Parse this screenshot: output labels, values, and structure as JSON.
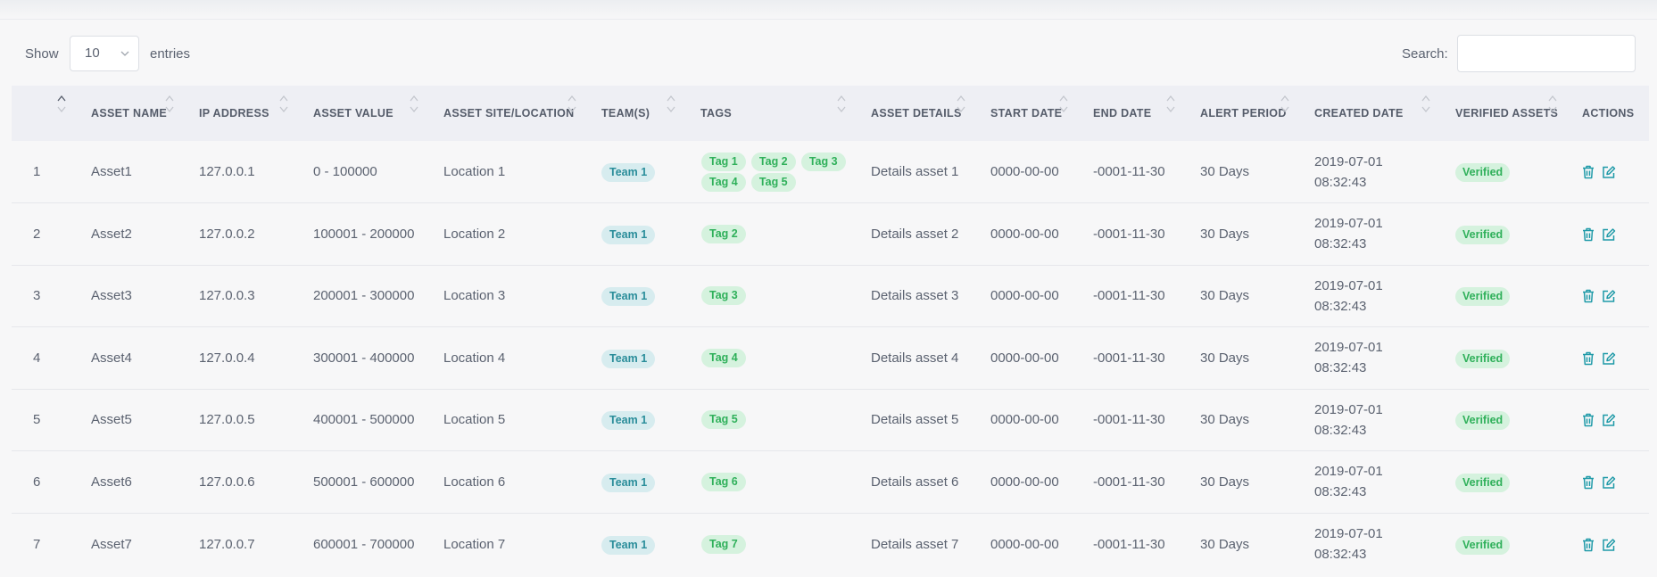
{
  "controls": {
    "show_label": "Show",
    "entries_value": "10",
    "entries_label": "entries",
    "search_label": "Search:",
    "search_value": ""
  },
  "columns": [
    {
      "key": "num",
      "label": ""
    },
    {
      "key": "name",
      "label": "ASSET NAME"
    },
    {
      "key": "ip",
      "label": "IP ADDRESS"
    },
    {
      "key": "value",
      "label": "ASSET VALUE"
    },
    {
      "key": "site",
      "label": "ASSET SITE/LOCATION"
    },
    {
      "key": "teams",
      "label": "TEAM(S)"
    },
    {
      "key": "tags",
      "label": "TAGS"
    },
    {
      "key": "details",
      "label": "ASSET DETAILS"
    },
    {
      "key": "start",
      "label": "START DATE"
    },
    {
      "key": "end",
      "label": "END DATE"
    },
    {
      "key": "alert",
      "label": "ALERT PERIOD"
    },
    {
      "key": "created",
      "label": "CREATED DATE"
    },
    {
      "key": "verified",
      "label": "VERIFIED ASSETS"
    },
    {
      "key": "actions",
      "label": "ACTIONS"
    }
  ],
  "rows": [
    {
      "num": "1",
      "name": "Asset1",
      "ip": "127.0.0.1",
      "value": "0 - 100000",
      "site": "Location 1",
      "team": "Team 1",
      "tags": [
        "Tag 1",
        "Tag 2",
        "Tag 3",
        "Tag 4",
        "Tag 5"
      ],
      "details": "Details asset 1",
      "start": "0000-00-00",
      "end": "-0001-11-30",
      "alert": "30 Days",
      "created": "2019-07-01 08:32:43",
      "verified": "Verified"
    },
    {
      "num": "2",
      "name": "Asset2",
      "ip": "127.0.0.2",
      "value": "100001 - 200000",
      "site": "Location 2",
      "team": "Team 1",
      "tags": [
        "Tag 2"
      ],
      "details": "Details asset 2",
      "start": "0000-00-00",
      "end": "-0001-11-30",
      "alert": "30 Days",
      "created": "2019-07-01 08:32:43",
      "verified": "Verified"
    },
    {
      "num": "3",
      "name": "Asset3",
      "ip": "127.0.0.3",
      "value": "200001 - 300000",
      "site": "Location 3",
      "team": "Team 1",
      "tags": [
        "Tag 3"
      ],
      "details": "Details asset 3",
      "start": "0000-00-00",
      "end": "-0001-11-30",
      "alert": "30 Days",
      "created": "2019-07-01 08:32:43",
      "verified": "Verified"
    },
    {
      "num": "4",
      "name": "Asset4",
      "ip": "127.0.0.4",
      "value": "300001 - 400000",
      "site": "Location 4",
      "team": "Team 1",
      "tags": [
        "Tag 4"
      ],
      "details": "Details asset 4",
      "start": "0000-00-00",
      "end": "-0001-11-30",
      "alert": "30 Days",
      "created": "2019-07-01 08:32:43",
      "verified": "Verified"
    },
    {
      "num": "5",
      "name": "Asset5",
      "ip": "127.0.0.5",
      "value": "400001 - 500000",
      "site": "Location 5",
      "team": "Team 1",
      "tags": [
        "Tag 5"
      ],
      "details": "Details asset 5",
      "start": "0000-00-00",
      "end": "-0001-11-30",
      "alert": "30 Days",
      "created": "2019-07-01 08:32:43",
      "verified": "Verified"
    },
    {
      "num": "6",
      "name": "Asset6",
      "ip": "127.0.0.6",
      "value": "500001 - 600000",
      "site": "Location 6",
      "team": "Team 1",
      "tags": [
        "Tag 6"
      ],
      "details": "Details asset 6",
      "start": "0000-00-00",
      "end": "-0001-11-30",
      "alert": "30 Days",
      "created": "2019-07-01 08:32:43",
      "verified": "Verified"
    },
    {
      "num": "7",
      "name": "Asset7",
      "ip": "127.0.0.7",
      "value": "600001 - 700000",
      "site": "Location 7",
      "team": "Team 1",
      "tags": [
        "Tag 7"
      ],
      "details": "Details asset 7",
      "start": "0000-00-00",
      "end": "-0001-11-30",
      "alert": "30 Days",
      "created": "2019-07-01 08:32:43",
      "verified": "Verified"
    }
  ],
  "icons": {
    "delete": "trash-icon",
    "edit": "edit-icon",
    "sort": "sort-icon",
    "dropdown": "chevron-down-icon"
  },
  "colors": {
    "team_badge_bg": "#d7ecef",
    "team_badge_text": "#2a8d9a",
    "tag_badge_bg": "#d5f2de",
    "tag_badge_text": "#2fb05a",
    "action_icon": "#1f9aa8",
    "header_bg": "#eeeff4"
  }
}
